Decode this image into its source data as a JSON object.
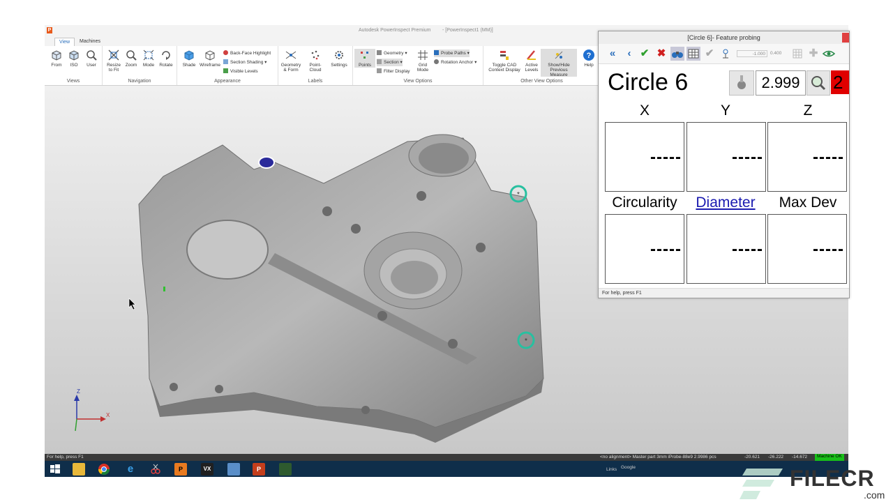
{
  "window": {
    "title": "Autodesk PowerInspect Premium",
    "doc_title": "- [PowerInspect1 (MM)]",
    "logo": "P"
  },
  "tabs": [
    {
      "label": "View",
      "active": true
    },
    {
      "label": "Machines",
      "active": false
    }
  ],
  "ribbon": {
    "views": {
      "label": "Views",
      "items": [
        "From",
        "ISO",
        "User"
      ]
    },
    "navigation": {
      "label": "Navigation",
      "items": [
        "Resize\nto Fit",
        "Zoom",
        "Mode",
        "Rotate"
      ]
    },
    "appearance": {
      "label": "Appearance",
      "items": [
        "Shade",
        "Wireframe"
      ],
      "small": [
        "Back-Face Highlight",
        "Section Shading",
        "Visible Levels"
      ]
    },
    "labels": {
      "label": "Labels",
      "items": [
        "Geometry\n& Form",
        "Point-Cloud",
        "Settings"
      ]
    },
    "view_options": {
      "label": "View Options",
      "items": [
        "Points",
        "Grid\nMode"
      ],
      "small": [
        "Geometry",
        "Section",
        "Filter Display",
        "Probe Paths",
        "Rotation Anchor"
      ]
    },
    "other_view": {
      "label": "Other View Options",
      "items": [
        "Toggle CAD\nContext Display",
        "Active\nLevels",
        "Show/Hide\nPrevious Measure",
        "Help"
      ]
    }
  },
  "dialog": {
    "title": "[Circle 6]- Feature probing",
    "toolbar_values": {
      "left": "-1.000",
      "right": "0.400"
    },
    "feature_name": "Circle 6",
    "probe_diameter": "2.999",
    "counter": "2",
    "columns_top": [
      "X",
      "Y",
      "Z"
    ],
    "columns_bottom": [
      "Circularity",
      "Diameter",
      "Max Dev"
    ],
    "cells": [
      "-----",
      "-----",
      "-----",
      "-----",
      "-----",
      "-----"
    ],
    "status": "For help, press F1"
  },
  "statusbar": {
    "left": "For help, press F1",
    "mid": "<no alignment>  Master part  3mm iProbe-88e9 2.9986  pcs",
    "x": "-20.621",
    "y": "-26.222",
    "z": "-14.672",
    "machine": "Machine OK"
  },
  "taskbar": {
    "links": "Links",
    "google": "Google"
  },
  "axes": {
    "z": "Z",
    "x": "X"
  },
  "watermark": {
    "brand": "FILECR",
    "tld": ".com"
  },
  "colors": {
    "accent": "#2a6ebb",
    "redbox": "#e00000",
    "taskbar": "#0f2e4a",
    "machine_ok": "#18c018"
  }
}
